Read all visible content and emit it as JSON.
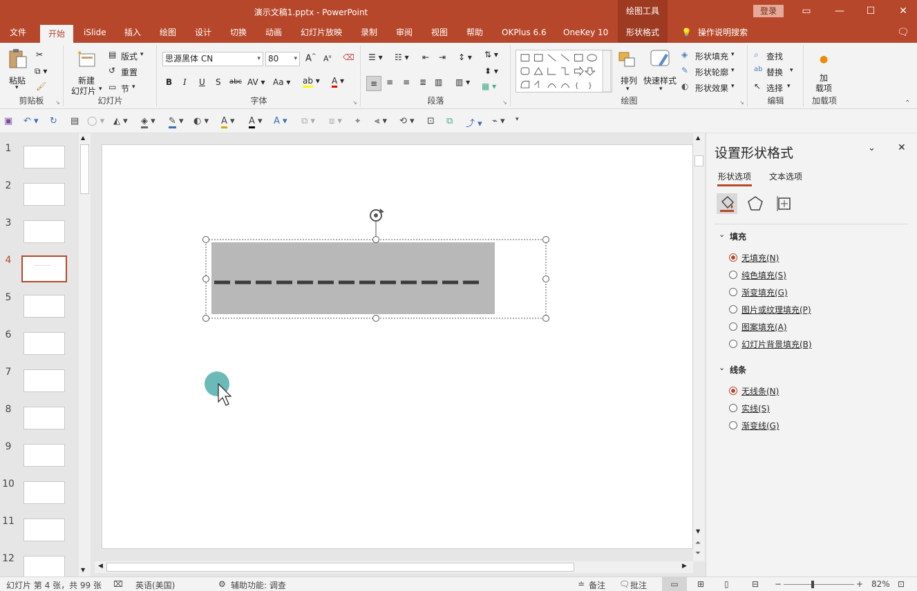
{
  "window": {
    "title": "演示文稿1.pptx  -  PowerPoint",
    "context_group": "绘图工具",
    "login_label": "登录"
  },
  "tabs": [
    {
      "label": "文件"
    },
    {
      "label": "开始"
    },
    {
      "label": "iSlide"
    },
    {
      "label": "插入"
    },
    {
      "label": "绘图"
    },
    {
      "label": "设计"
    },
    {
      "label": "切换"
    },
    {
      "label": "动画"
    },
    {
      "label": "幻灯片放映"
    },
    {
      "label": "录制"
    },
    {
      "label": "审阅"
    },
    {
      "label": "视图"
    },
    {
      "label": "帮助"
    },
    {
      "label": "OKPlus 6.6"
    },
    {
      "label": "OneKey 10"
    },
    {
      "label": "形状格式"
    }
  ],
  "search_label": "操作说明搜索",
  "ribbon": {
    "clipboard": {
      "paste": "粘贴",
      "group": "剪贴板"
    },
    "slides": {
      "new_slide_1": "新建",
      "new_slide_2": "幻灯片",
      "layout": "版式",
      "reset": "重置",
      "section": "节",
      "group": "幻灯片"
    },
    "font": {
      "font_name": "思源黑体 CN",
      "font_size": "80",
      "group": "字体"
    },
    "paragraph": {
      "group": "段落"
    },
    "drawing": {
      "arrange": "排列",
      "quick_styles": "快速样式",
      "shape_fill": "形状填充",
      "shape_outline": "形状轮廓",
      "shape_effects": "形状效果",
      "group": "绘图"
    },
    "editing": {
      "find": "查找",
      "replace": "替换",
      "select": "选择",
      "group": "编辑"
    },
    "addins": {
      "label_1": "加",
      "label_2": "载项",
      "group": "加载项"
    }
  },
  "thumbnails": {
    "numbers": [
      "1",
      "2",
      "3",
      "4",
      "5",
      "6",
      "7",
      "8",
      "9",
      "10",
      "11",
      "12"
    ],
    "selected": "4"
  },
  "format_pane": {
    "title": "设置形状格式",
    "tab_shape": "形状选项",
    "tab_text": "文本选项",
    "fill_section": "填充",
    "fill_options": [
      {
        "label": "无填充(N)",
        "selected": true
      },
      {
        "label": "纯色填充(S)",
        "selected": false
      },
      {
        "label": "渐变填充(G)",
        "selected": false
      },
      {
        "label": "图片或纹理填充(P)",
        "selected": false
      },
      {
        "label": "图案填充(A)",
        "selected": false
      },
      {
        "label": "幻灯片背景填充(B)",
        "selected": false
      }
    ],
    "line_section": "线条",
    "line_options": [
      {
        "label": "无线条(N)",
        "selected": true
      },
      {
        "label": "实线(S)",
        "selected": false
      },
      {
        "label": "渐变线(G)",
        "selected": false
      }
    ]
  },
  "status": {
    "slide_info": "幻灯片 第 4 张，共 99 张",
    "language": "英语(美国)",
    "accessibility": "辅助功能: 调查",
    "notes": "备注",
    "comments": "批注",
    "zoom": "82%"
  },
  "colors": {
    "accent": "#b7472a",
    "shape_fill": "#b8b8b8",
    "cursor_highlight": "#5bb3b0"
  }
}
